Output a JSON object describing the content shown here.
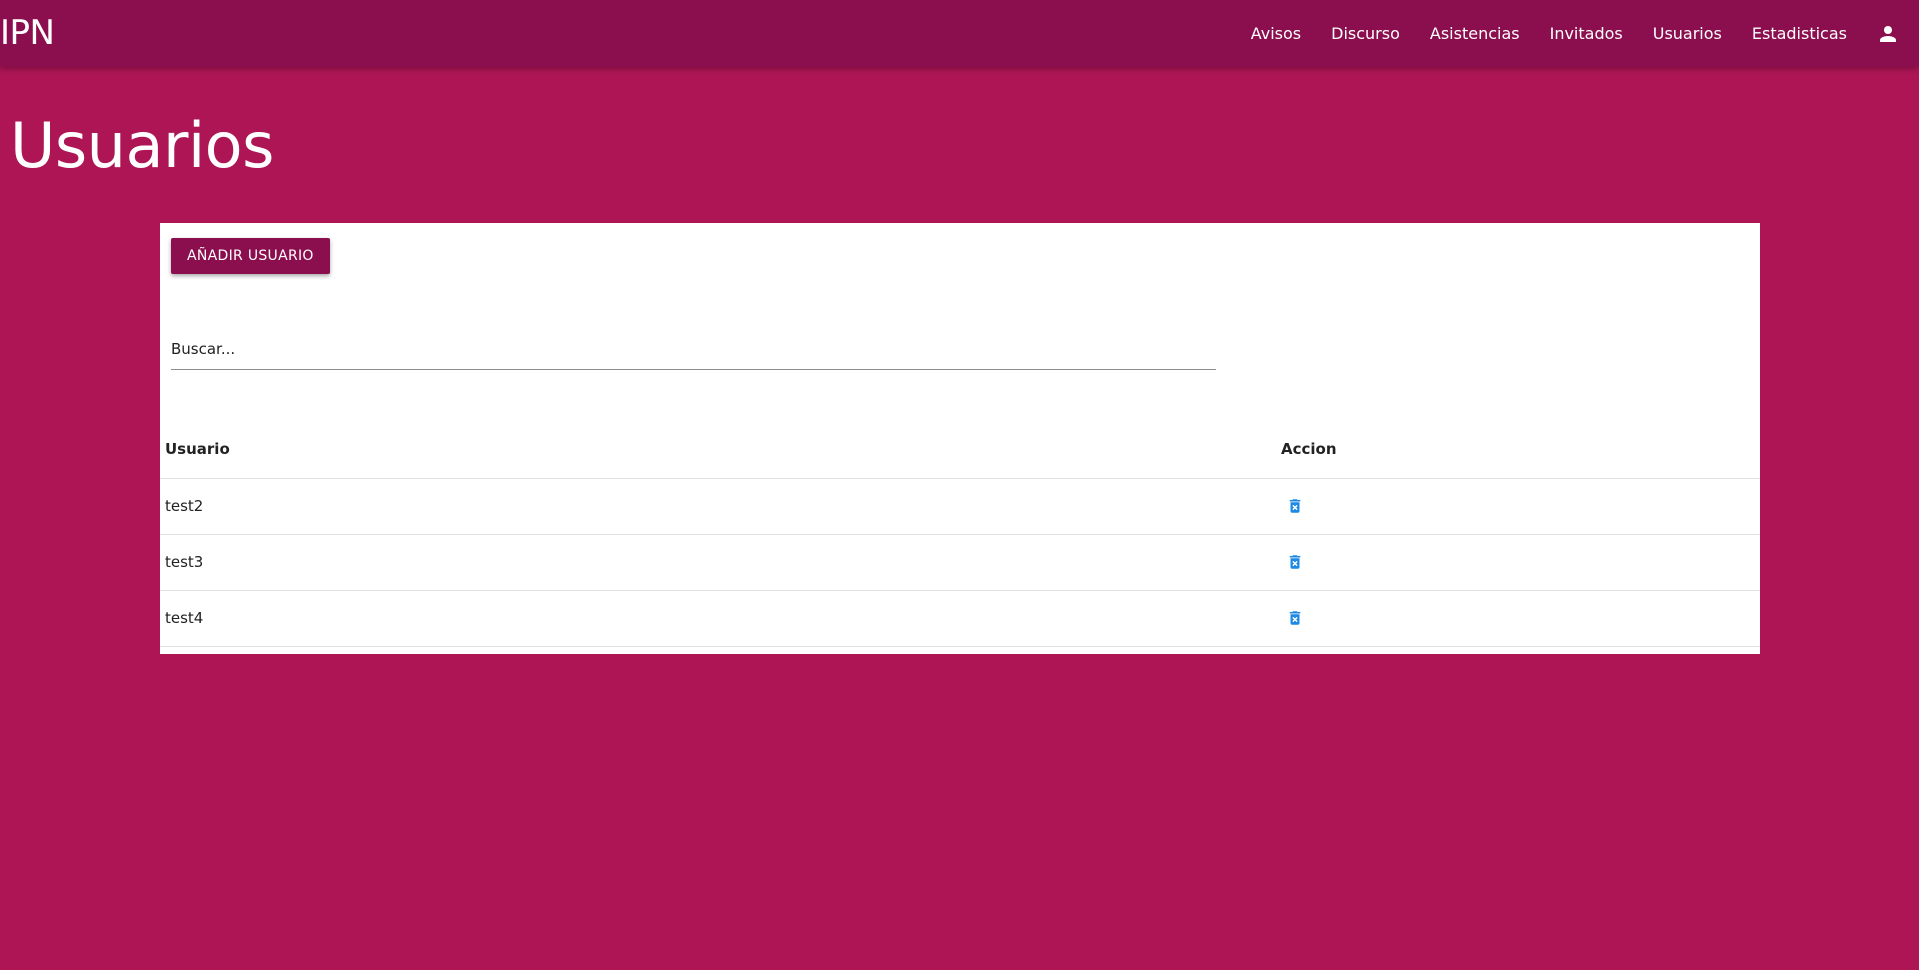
{
  "navbar": {
    "brand": "IPN",
    "links": [
      {
        "label": "Avisos"
      },
      {
        "label": "Discurso"
      },
      {
        "label": "Asistencias"
      },
      {
        "label": "Invitados"
      },
      {
        "label": "Usuarios"
      },
      {
        "label": "Estadisticas"
      }
    ],
    "user_icon": "account-icon"
  },
  "page": {
    "title": "Usuarios"
  },
  "toolbar": {
    "add_label": "AÑADIR USUARIO"
  },
  "search": {
    "placeholder": "Buscar..."
  },
  "table": {
    "headers": {
      "user": "Usuario",
      "action": "Accion"
    },
    "rows": [
      {
        "user": "test2",
        "action_icon": "delete-forever-icon"
      },
      {
        "user": "test3",
        "action_icon": "delete-forever-icon"
      },
      {
        "user": "test4",
        "action_icon": "delete-forever-icon"
      }
    ]
  },
  "colors": {
    "background": "#ad1555",
    "navbar": "#8b0f4e",
    "button": "#8b0f4e",
    "delete_icon": "#1e88e5",
    "card": "#ffffff"
  }
}
